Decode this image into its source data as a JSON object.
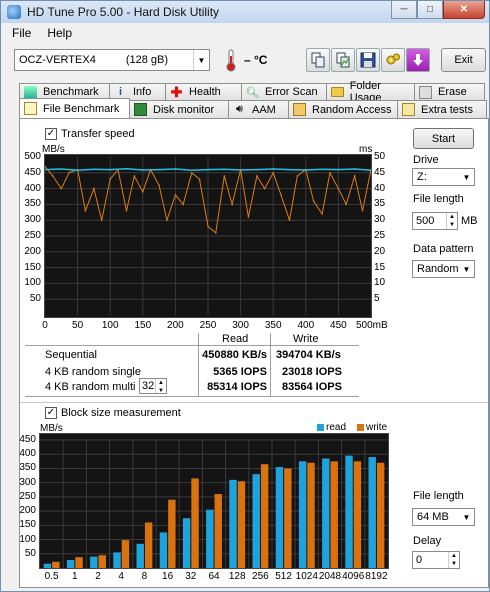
{
  "window": {
    "title": "HD Tune Pro 5.00 - Hard Disk Utility",
    "min_label": "─",
    "max_label": "□",
    "close_label": "✕"
  },
  "menu": [
    "File",
    "Help"
  ],
  "toolbar": {
    "drive_name": "OCZ-VERTEX4",
    "drive_size": "(128 gB)",
    "temperature": "– °C",
    "exit_label": "Exit"
  },
  "tabs_row1": [
    "Benchmark",
    "Info",
    "Health",
    "Error Scan",
    "Folder Usage",
    "Erase"
  ],
  "tabs_row2": [
    "File Benchmark",
    "Disk monitor",
    "AAM",
    "Random Access",
    "Extra tests"
  ],
  "transfer": {
    "checkbox_label": "Transfer speed",
    "checked": true,
    "y_unit_left": "MB/s",
    "y_unit_right": "ms",
    "y_ticks_left": [
      "500",
      "450",
      "400",
      "350",
      "300",
      "250",
      "200",
      "150",
      "100",
      "50"
    ],
    "y_ticks_right": [
      "50",
      "45",
      "40",
      "35",
      "30",
      "25",
      "20",
      "15",
      "10",
      "5"
    ],
    "x_ticks": [
      "0",
      "50",
      "100",
      "150",
      "200",
      "250",
      "300",
      "350",
      "400",
      "450",
      "500mB"
    ]
  },
  "results": {
    "col_read": "Read",
    "col_write": "Write",
    "rows": [
      {
        "label": "Sequential",
        "read": "450880 KB/s",
        "write": "394704 KB/s"
      },
      {
        "label": "4 KB random single",
        "read": "5365 IOPS",
        "write": "23018 IOPS"
      },
      {
        "label": "4 KB random multi",
        "read": "85314 IOPS",
        "write": "83564 IOPS"
      }
    ],
    "queue_depth": "32"
  },
  "side_top": {
    "start_label": "Start",
    "drive_label": "Drive",
    "drive_value": "Z:",
    "file_length_label": "File length",
    "file_length_value": "500",
    "file_length_unit": "MB",
    "pattern_label": "Data pattern",
    "pattern_value": "Random"
  },
  "block": {
    "checkbox_label": "Block size measurement",
    "checked": true,
    "y_unit": "MB/s",
    "legend_read": "read",
    "legend_write": "write"
  },
  "side_bottom": {
    "file_length_label": "File length",
    "file_length_value": "64 MB",
    "delay_label": "Delay",
    "delay_value": "0"
  },
  "colors": {
    "read": "#1fa3dc",
    "write": "#d9720f",
    "transfer_read": "#21c2e6",
    "access": "#e07b16"
  },
  "chart_data": [
    {
      "type": "line",
      "title": "",
      "xlabel": "",
      "ylabel": "MB/s",
      "xlim": [
        0,
        500
      ],
      "ylim": [
        0,
        500
      ],
      "y2label": "ms",
      "y2lim": [
        0,
        50
      ],
      "grid": true,
      "series": [
        {
          "name": "",
          "axis": "left",
          "x": [
            0,
            25,
            50,
            75,
            100,
            125,
            150,
            175,
            200,
            225,
            250,
            275,
            300,
            325,
            350,
            375,
            400,
            425,
            450,
            475,
            500
          ],
          "y": [
            460,
            462,
            458,
            461,
            460,
            463,
            459,
            460,
            462,
            458,
            460,
            461,
            459,
            460,
            462,
            460,
            459,
            461,
            460,
            462,
            458
          ]
        },
        {
          "name": "",
          "axis": "right",
          "x": [
            0,
            12,
            25,
            37,
            50,
            62,
            75,
            87,
            100,
            112,
            125,
            137,
            150,
            162,
            175,
            187,
            200,
            212,
            225,
            237,
            250,
            262,
            275,
            287,
            300,
            312,
            325,
            337,
            350,
            362,
            375,
            387,
            400,
            412,
            425,
            437,
            450,
            462,
            475,
            487,
            500
          ],
          "y": [
            47,
            44,
            40,
            45,
            46,
            33,
            40,
            30,
            43,
            46,
            33,
            44,
            39,
            46,
            41,
            30,
            38,
            35,
            45,
            43,
            28,
            26,
            44,
            35,
            46,
            31,
            44,
            40,
            45,
            38,
            30,
            44,
            46,
            36,
            32,
            45,
            40,
            35,
            44,
            33,
            46
          ]
        }
      ]
    },
    {
      "type": "bar",
      "title": "",
      "xlabel": "",
      "ylabel": "MB/s",
      "ylim": [
        0,
        450
      ],
      "grid": true,
      "legend": "top-right",
      "categories": [
        "0.5",
        "1",
        "2",
        "4",
        "8",
        "16",
        "32",
        "64",
        "128",
        "256",
        "512",
        "1024",
        "2048",
        "4096",
        "8192"
      ],
      "series": [
        {
          "name": "read",
          "values": [
            15,
            28,
            40,
            55,
            85,
            125,
            175,
            205,
            310,
            330,
            355,
            375,
            385,
            395,
            390
          ]
        },
        {
          "name": "write",
          "values": [
            22,
            38,
            45,
            98,
            160,
            240,
            315,
            260,
            305,
            365,
            350,
            370,
            375,
            375,
            370
          ]
        }
      ]
    }
  ]
}
